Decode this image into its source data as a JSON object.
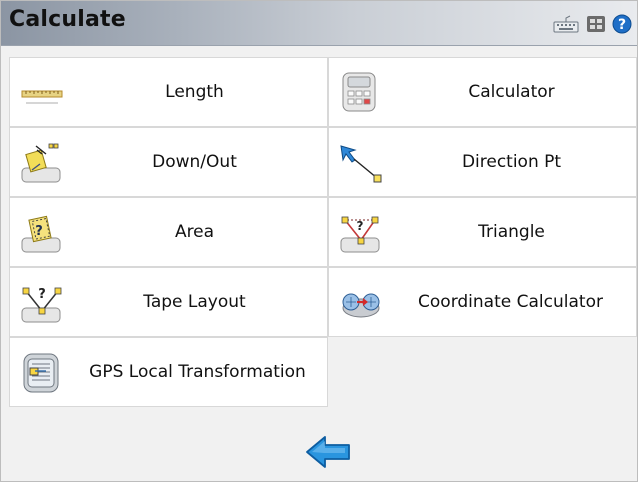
{
  "header": {
    "title": "Calculate",
    "icons": [
      "keyboard-icon",
      "grid-icon",
      "help-icon"
    ]
  },
  "menu": [
    {
      "id": "length",
      "label": "Length",
      "icon": "ruler-icon"
    },
    {
      "id": "calculator",
      "label": "Calculator",
      "icon": "calculator-icon"
    },
    {
      "id": "down-out",
      "label": "Down/Out",
      "icon": "down-out-icon"
    },
    {
      "id": "direction-pt",
      "label": "Direction Pt",
      "icon": "direction-point-icon"
    },
    {
      "id": "area",
      "label": "Area",
      "icon": "area-icon"
    },
    {
      "id": "triangle",
      "label": "Triangle",
      "icon": "triangle-icon"
    },
    {
      "id": "tape-layout",
      "label": "Tape Layout",
      "icon": "tape-layout-icon"
    },
    {
      "id": "coordinate-calculator",
      "label": "Coordinate Calculator",
      "icon": "coordinate-calculator-icon"
    },
    {
      "id": "gps-local-transformation",
      "label": "GPS Local Transformation",
      "icon": "gps-transform-icon"
    }
  ],
  "footer": {
    "back_icon": "back-arrow-icon"
  },
  "colors": {
    "accent_blue": "#1f8fd8",
    "yellow": "#f3e06b",
    "titlebar": "#8b95a3"
  }
}
